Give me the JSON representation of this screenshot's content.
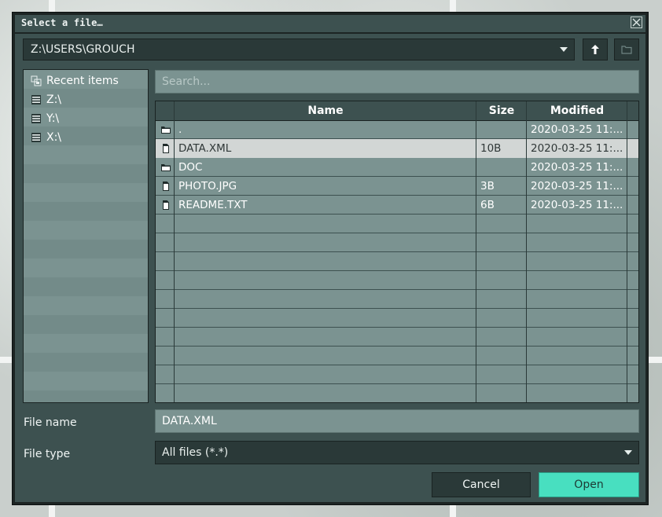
{
  "window": {
    "title": "Select a file…"
  },
  "path": {
    "value": "Z:\\USERS\\GROUCH"
  },
  "places": [
    {
      "label": "Recent items",
      "icon": "recent-items-icon"
    },
    {
      "label": "Z:\\",
      "icon": "drive-icon"
    },
    {
      "label": "Y:\\",
      "icon": "drive-icon"
    },
    {
      "label": "X:\\",
      "icon": "drive-icon"
    }
  ],
  "search": {
    "placeholder": "Search..."
  },
  "table": {
    "columns": [
      "Name",
      "Size",
      "Modified"
    ],
    "rows": [
      {
        "name": ".",
        "size": "",
        "modified": "2020-03-25 11:...",
        "kind": "folder"
      },
      {
        "name": "DATA.XML",
        "size": "10B",
        "modified": "2020-03-25 11:...",
        "kind": "file",
        "selected": true
      },
      {
        "name": "DOC",
        "size": "",
        "modified": "2020-03-25 11:...",
        "kind": "folder"
      },
      {
        "name": "PHOTO.JPG",
        "size": "3B",
        "modified": "2020-03-25 11:...",
        "kind": "file"
      },
      {
        "name": "README.TXT",
        "size": "6B",
        "modified": "2020-03-25 11:...",
        "kind": "file"
      }
    ]
  },
  "form": {
    "file_name_label": "File name",
    "file_name_value": "DATA.XML",
    "file_type_label": "File type",
    "file_type_value": "All files (*.*)"
  },
  "buttons": {
    "cancel": "Cancel",
    "open": "Open"
  },
  "colors": {
    "accent": "#48dfc0",
    "selected_row": "#d2d6d5",
    "panel": "#3d5150"
  }
}
